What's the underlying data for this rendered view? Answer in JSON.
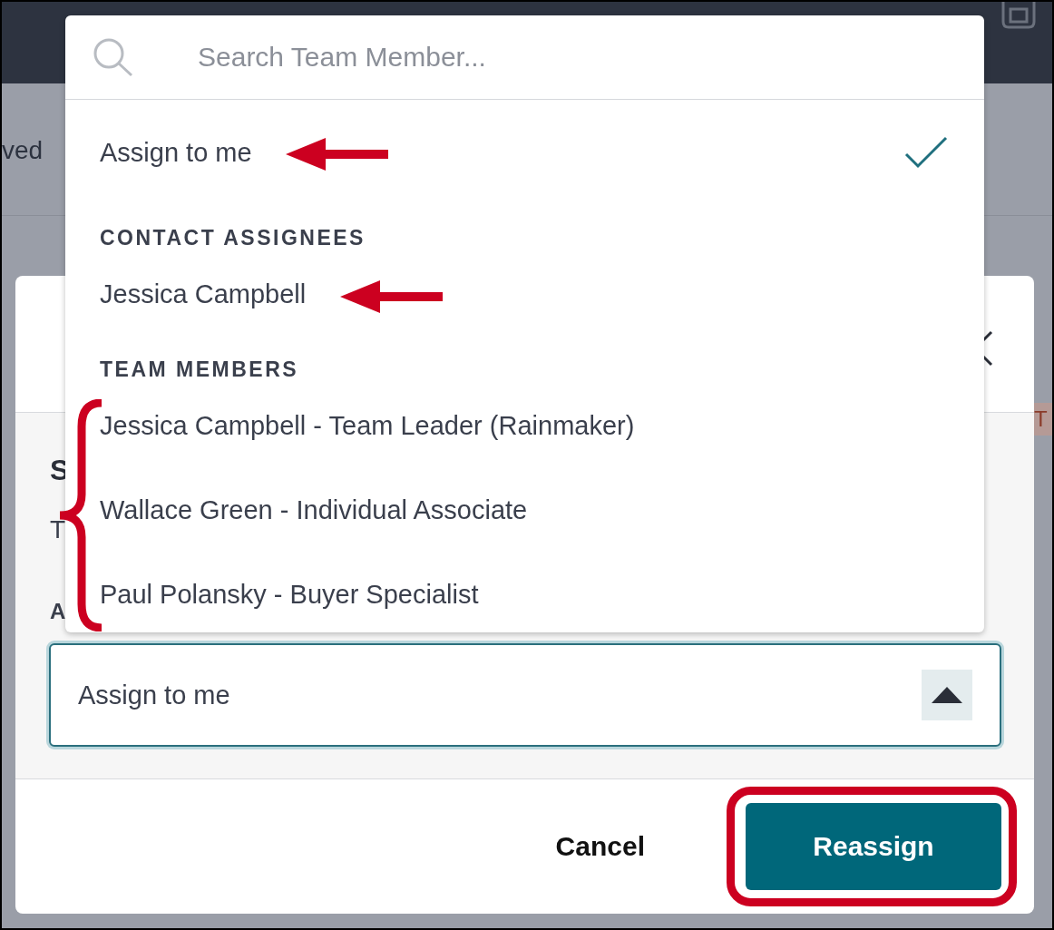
{
  "background": {
    "fragments": [
      {
        "kind": "tab",
        "text": "ved"
      },
      {
        "kind": "tag",
        "text": "T"
      }
    ]
  },
  "modal": {
    "section_heading": "S",
    "section_text": "T",
    "field_label": "A",
    "select": {
      "value": "Assign to me",
      "expanded": true
    },
    "buttons": [
      {
        "kind": "secondary",
        "label": "Cancel"
      },
      {
        "kind": "primary",
        "label": "Reassign"
      }
    ]
  },
  "dropdown": {
    "search": {
      "placeholder": "Search Team Member..."
    },
    "items": [
      {
        "kind": "option",
        "label": "Assign to me",
        "selected": true
      },
      {
        "kind": "heading",
        "label": "CONTACT ASSIGNEES"
      },
      {
        "kind": "option",
        "label": "Jessica Campbell",
        "selected": false
      },
      {
        "kind": "heading",
        "label": "TEAM MEMBERS"
      },
      {
        "kind": "option",
        "label": "Jessica Campbell - Team Leader (Rainmaker)",
        "selected": false
      },
      {
        "kind": "option",
        "label": "Wallace Green - Individual Associate",
        "selected": false
      },
      {
        "kind": "option",
        "label": "Paul Polansky - Buyer Specialist",
        "selected": false
      }
    ]
  }
}
